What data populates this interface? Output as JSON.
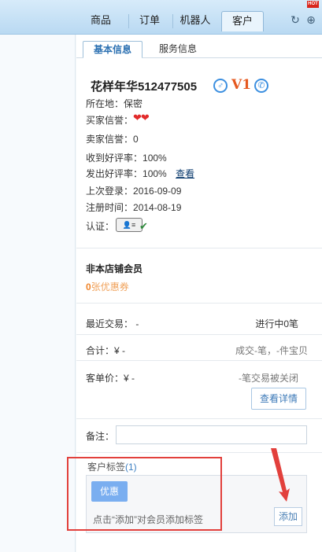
{
  "nav": {
    "tabs": [
      {
        "label": "商品"
      },
      {
        "label": "订单"
      },
      {
        "label": "机器人"
      },
      {
        "label": "客户"
      }
    ],
    "hot_label": "HOT",
    "refresh_icon": "refresh-icon",
    "add_icon": "plus-circle-icon"
  },
  "subtabs": [
    {
      "label": "基本信息"
    },
    {
      "label": "服务信息"
    }
  ],
  "profile": {
    "name": "花样年华512477505",
    "gender_icon": "male-icon",
    "vip_label": "V1",
    "phone_icon": "phone-icon",
    "location_label": "所在地：",
    "location_value": "保密",
    "buyer_credit_label": "买家信誉：",
    "seller_credit_label": "卖家信誉：",
    "seller_credit_value": "0",
    "received_rate_label": "收到好评率：",
    "received_rate_value": "100%",
    "given_rate_label": "发出好评率：",
    "given_rate_value": "100%",
    "view_link": "查看",
    "last_login_label": "上次登录：",
    "last_login_value": "2016-09-09",
    "register_label": "注册时间：",
    "register_value": "2014-08-19",
    "cert_label": "认证："
  },
  "membership": {
    "title": "非本店铺会员",
    "coupon_count": "0",
    "coupon_suffix": "张优惠券"
  },
  "stats": {
    "recent_label": "最近交易：",
    "recent_value": "-",
    "in_progress": "进行中0笔",
    "total_label": "合计：",
    "total_value": "¥ -",
    "total_desc": "成交-笔，-件宝贝",
    "avg_label": "客单价：",
    "avg_value": "¥ -",
    "avg_desc": "-笔交易被关闭",
    "detail_button": "查看详情"
  },
  "remark": {
    "label": "备注：",
    "value": ""
  },
  "tags": {
    "title": "客户标签",
    "count": "(1)",
    "chip": "优惠",
    "hint": "点击“添加”对会员添加标签",
    "add_button": "添加"
  },
  "colors": {
    "accent": "#3c8fe0",
    "coupon": "#f0852b",
    "annotation": "#e2403c"
  }
}
